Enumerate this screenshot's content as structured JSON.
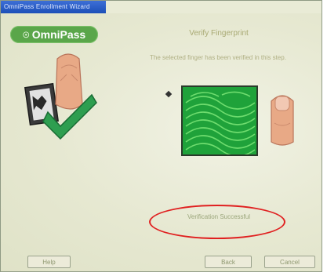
{
  "window": {
    "title": "OmniPass Enrollment Wizard"
  },
  "brand": {
    "logo_text": "OmniPass"
  },
  "main": {
    "heading": "Verify Fingerprint",
    "instruction": "The selected finger has been verified in this step.",
    "result": "Verification Successful"
  },
  "buttons": {
    "help": "Help",
    "back": "Back",
    "cancel": "Cancel"
  },
  "colors": {
    "brand_green": "#5aa64a",
    "fingerprint_green": "#1fa23a",
    "highlight_red": "#e02020"
  },
  "icons": {
    "logo_mark": "fingerprint-logo-icon",
    "illustration": "finger-check-icon",
    "bullet": "bullet-icon",
    "fingerprint_scan": "fingerprint-scan-icon",
    "finger": "finger-icon"
  }
}
